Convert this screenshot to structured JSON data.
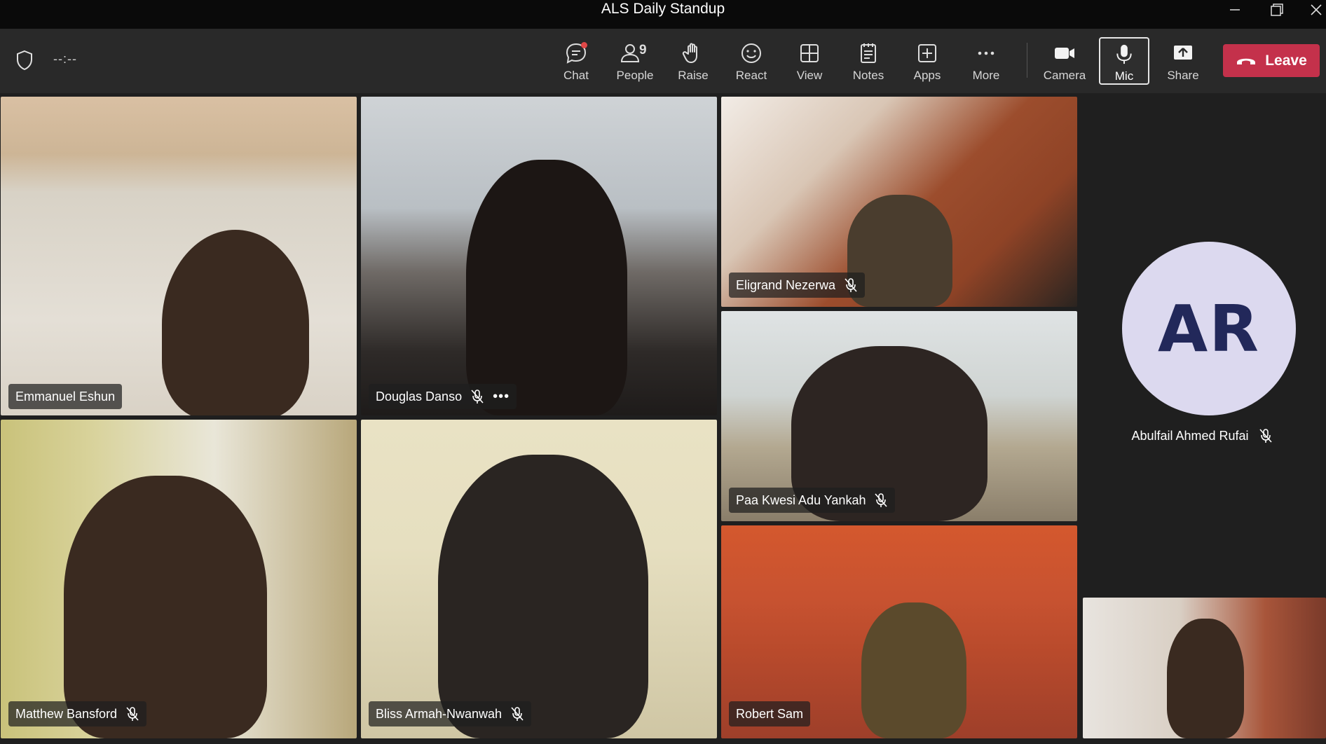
{
  "window": {
    "title": "ALS Daily Standup"
  },
  "toolbar": {
    "timer": "--:--",
    "people_count": "9",
    "buttons": {
      "chat": "Chat",
      "people": "People",
      "raise": "Raise",
      "react": "React",
      "view": "View",
      "notes": "Notes",
      "apps": "Apps",
      "more": "More",
      "camera": "Camera",
      "mic": "Mic",
      "share": "Share"
    },
    "leave": "Leave"
  },
  "participants": [
    {
      "name": "Emmanuel Eshun"
    },
    {
      "name": "Douglas Danso"
    },
    {
      "name": "Eligrand Nezerwa"
    },
    {
      "name": "Paa Kwesi Adu Yankah"
    },
    {
      "name": "Matthew Bansford"
    },
    {
      "name": "Bliss Armah-Nwanwah"
    },
    {
      "name": "Robert Sam"
    }
  ],
  "avatar_participant": {
    "initials": "AR",
    "name": "Abulfail Ahmed Rufai"
  },
  "colors": {
    "leave": "#c4314b",
    "avatar_bg": "#dcd9ef",
    "avatar_text": "#22285a"
  }
}
